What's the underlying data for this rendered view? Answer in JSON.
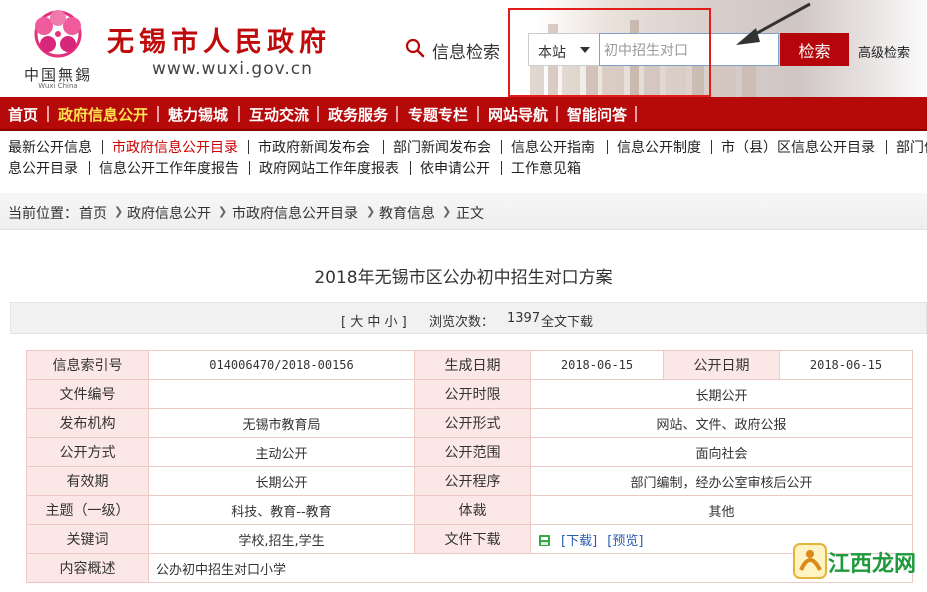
{
  "header": {
    "site_title": "无锡市人民政府",
    "site_url": "www.wuxi.gov.cn",
    "logo_text": "中国無錫",
    "logo_subtext": "Wuxi China",
    "search_label": "信息检索",
    "scope": "本站",
    "search_value": "初中招生对口",
    "search_button": "检索",
    "advanced_search": "高级检索"
  },
  "nav": [
    "首页",
    "政府信息公开",
    "魅力锡城",
    "互动交流",
    "政务服务",
    "专题专栏",
    "网站导航",
    "智能问答"
  ],
  "subnav": {
    "row1": [
      "最新公开信息",
      "市政府信息公开目录",
      "市政府新闻发布会",
      "部门新闻发布会",
      "信息公开指南",
      "信息公开制度",
      "市（县）区信息公开目录",
      "部门信"
    ],
    "row2": [
      "息公开目录",
      "信息公开工作年度报告",
      "政府网站工作年度报表",
      "依申请公开",
      "工作意见箱"
    ]
  },
  "breadcrumb": {
    "prefix": "当前位置：",
    "items": [
      "首页",
      "政府信息公开",
      "市政府信息公开目录",
      "教育信息",
      "正文"
    ]
  },
  "article": {
    "title": "2018年无锡市区公办初中招生对口方案"
  },
  "toolbar": {
    "font_sizes": "[ 大 中 小 ]",
    "views_label": "浏览次数：",
    "views": "1397",
    "download_all": "全文下载"
  },
  "meta": {
    "index_label": "信息索引号",
    "index_value": "014006470/2018-00156",
    "created_label": "生成日期",
    "created_value": "2018-06-15",
    "published_label": "公开日期",
    "published_value": "2018-06-15",
    "docno_label": "文件编号",
    "docno_value": "",
    "period_label": "公开时限",
    "period_value": "长期公开",
    "org_label": "发布机构",
    "org_value": "无锡市教育局",
    "form_label": "公开形式",
    "form_value": "网站、文件、政府公报",
    "method_label": "公开方式",
    "method_value": "主动公开",
    "scope_label": "公开范围",
    "scope_value": "面向社会",
    "validity_label": "有效期",
    "validity_value": "长期公开",
    "procedure_label": "公开程序",
    "procedure_value": "部门编制，经办公室审核后公开",
    "topic_label": "主题（一级）",
    "topic_value": "科技、教育--教育",
    "genre_label": "体裁",
    "genre_value": "其他",
    "keywords_label": "关键词",
    "keywords_value": "学校,招生,学生",
    "filedl_label": "文件下载",
    "download_link": "[下载]",
    "preview_link": "[预览]",
    "summary_label": "内容概述",
    "summary_value": "公办初中招生对口小学"
  },
  "watermark": "江西龙网",
  "colors": {
    "brand_red": "#b5090a",
    "nav_active": "#ffe14d",
    "label_bg": "#fbe8e6",
    "link_blue": "#2a5db0"
  }
}
